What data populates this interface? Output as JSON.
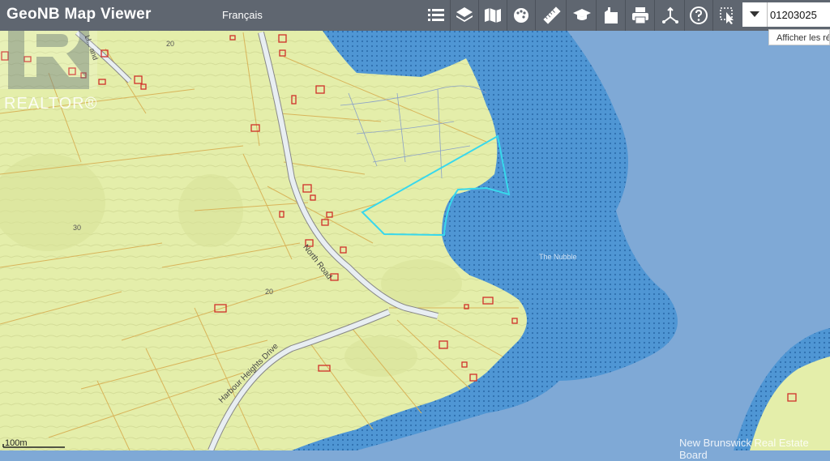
{
  "header": {
    "app_title": "GeoNB Map Viewer",
    "language_link": "Français"
  },
  "toolbar": {
    "tools": [
      {
        "icon": "legend-list-icon"
      },
      {
        "icon": "layers-icon"
      },
      {
        "icon": "basemap-icon"
      },
      {
        "icon": "themes-icon"
      },
      {
        "icon": "measure-icon"
      },
      {
        "icon": "learning-icon"
      },
      {
        "icon": "property-icon"
      },
      {
        "icon": "print-icon"
      },
      {
        "icon": "share-icon"
      },
      {
        "icon": "help-icon"
      },
      {
        "icon": "identify-icon"
      }
    ]
  },
  "search": {
    "value": "01203025",
    "dropdown_hint": "Afficher les ré"
  },
  "watermark": {
    "text": "REALTOR®"
  },
  "map": {
    "scale_label": "100m",
    "credit": "New Brunswick Real Estate Board",
    "labels": {
      "north_road": "North Road",
      "harbour_heights": "Harbour Heights Drive",
      "the_nubble": "The Nubble",
      "contour_20a": "20",
      "contour_30": "30",
      "contour_20b": "20",
      "road_top": "Ll... and"
    },
    "colors": {
      "land": "#e4eeaa",
      "water": "#7fa9d6",
      "shore": "#4f96d4",
      "parcel_lines": "#d8b45a",
      "buildings": "#d0302a",
      "selected_parcel": "#38d8ec"
    }
  }
}
